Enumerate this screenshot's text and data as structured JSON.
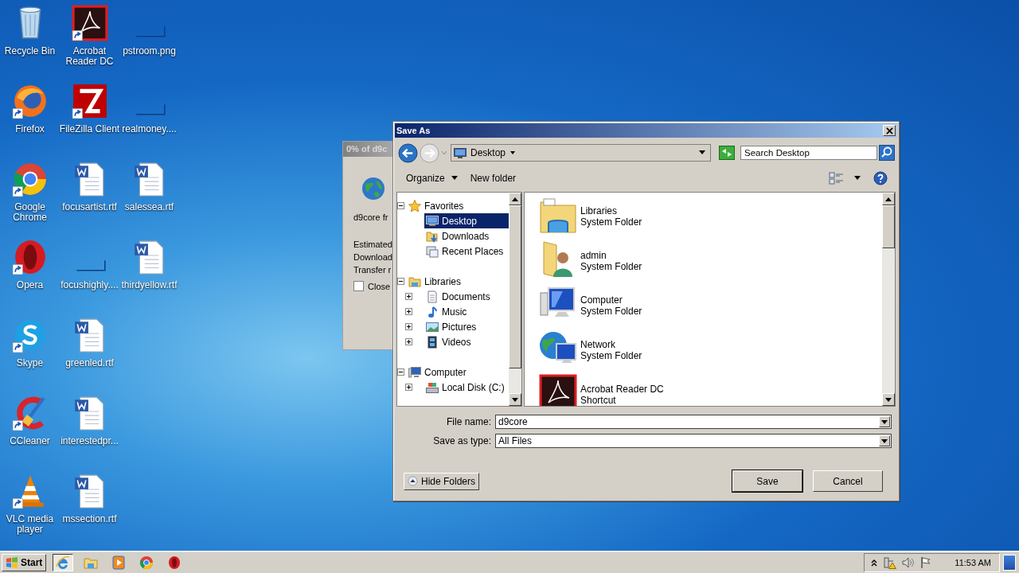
{
  "desktop_icons": [
    {
      "kind": "recycle-bin",
      "label": "Recycle Bin",
      "shortcut": false
    },
    {
      "kind": "firefox",
      "label": "Firefox",
      "shortcut": true
    },
    {
      "kind": "chrome",
      "label": "Google Chrome",
      "shortcut": true
    },
    {
      "kind": "opera",
      "label": "Opera",
      "shortcut": true
    },
    {
      "kind": "skype",
      "label": "Skype",
      "shortcut": true
    },
    {
      "kind": "ccleaner",
      "label": "CCleaner",
      "shortcut": true
    },
    {
      "kind": "vlc",
      "label": "VLC media player",
      "shortcut": true
    },
    {
      "kind": "acrobat",
      "label": "Acrobat Reader DC",
      "shortcut": true
    },
    {
      "kind": "filezilla",
      "label": "FileZilla Client",
      "shortcut": true
    },
    {
      "kind": "word",
      "label": "focusartist.rtf",
      "shortcut": false
    },
    {
      "kind": "blank",
      "label": "focushighly....",
      "shortcut": false
    },
    {
      "kind": "word",
      "label": "greenled.rtf",
      "shortcut": false
    },
    {
      "kind": "word",
      "label": "interestedpr...",
      "shortcut": false
    },
    {
      "kind": "word",
      "label": "mssection.rtf",
      "shortcut": false
    },
    {
      "kind": "blank",
      "label": "pstroom.png",
      "shortcut": false
    },
    {
      "kind": "blank",
      "label": "realmoney....",
      "shortcut": false
    },
    {
      "kind": "word",
      "label": "salessea.rtf",
      "shortcut": false
    },
    {
      "kind": "word",
      "label": "thirdyellow.rtf",
      "shortcut": false
    }
  ],
  "download_window": {
    "title": "0% of d9c",
    "source": "d9core fr",
    "lines": [
      "Estimated",
      "Download",
      "Transfer r"
    ],
    "close_option": {
      "label": "Close",
      "checked": false
    }
  },
  "save_dialog": {
    "title": "Save As",
    "address": {
      "location": "Desktop"
    },
    "search": {
      "placeholder": "Search Desktop"
    },
    "toolbar": {
      "organize": "Organize",
      "new_folder": "New folder"
    },
    "tree": [
      {
        "kind": "favorites",
        "label": "Favorites",
        "expanded": true,
        "selected": false,
        "children": [
          {
            "kind": "desktop",
            "label": "Desktop",
            "selected": true
          },
          {
            "kind": "downloads",
            "label": "Downloads",
            "selected": false
          },
          {
            "kind": "recent",
            "label": "Recent Places",
            "selected": false
          }
        ]
      },
      {
        "kind": "libraries",
        "label": "Libraries",
        "expanded": true,
        "selected": false,
        "children": [
          {
            "kind": "documents",
            "label": "Documents",
            "expanded": false,
            "selected": false
          },
          {
            "kind": "music",
            "label": "Music",
            "expanded": false,
            "selected": false
          },
          {
            "kind": "pictures",
            "label": "Pictures",
            "expanded": false,
            "selected": false
          },
          {
            "kind": "videos",
            "label": "Videos",
            "expanded": false,
            "selected": false
          }
        ]
      },
      {
        "kind": "computer",
        "label": "Computer",
        "expanded": true,
        "selected": false,
        "children": [
          {
            "kind": "disk",
            "label": "Local Disk (C:)",
            "expanded": false,
            "selected": false
          }
        ]
      }
    ],
    "files": [
      {
        "kind": "libraries",
        "name": "Libraries",
        "type": "System Folder"
      },
      {
        "kind": "user",
        "name": "admin",
        "type": "System Folder"
      },
      {
        "kind": "computer",
        "name": "Computer",
        "type": "System Folder"
      },
      {
        "kind": "network",
        "name": "Network",
        "type": "System Folder"
      },
      {
        "kind": "acrobat",
        "name": "Acrobat Reader DC",
        "type": "Shortcut"
      }
    ],
    "file_name": {
      "label": "File name:",
      "value": "d9core"
    },
    "save_as_type": {
      "label": "Save as type:",
      "value": "All Files"
    },
    "hide_folders": "Hide Folders",
    "buttons": [
      "Save",
      "Cancel"
    ]
  },
  "taskbar": {
    "start": "Start",
    "apps": [
      {
        "kind": "ie",
        "selected": true
      },
      {
        "kind": "explorer",
        "selected": false
      },
      {
        "kind": "player",
        "selected": false
      },
      {
        "kind": "chrome",
        "selected": false
      },
      {
        "kind": "opera",
        "selected": false
      }
    ],
    "clock": "11:53 AM"
  }
}
